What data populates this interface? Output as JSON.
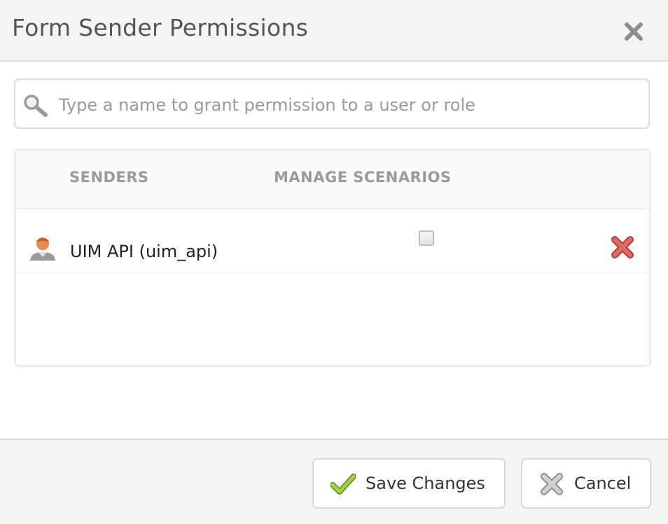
{
  "dialog": {
    "title": "Form Sender Permissions",
    "close_icon": "close-icon"
  },
  "search": {
    "icon": "search-icon",
    "placeholder": "Type a name to grant permission to a user or role",
    "value": ""
  },
  "table": {
    "columns": [
      "SENDERS",
      "MANAGE SCENARIOS"
    ],
    "rows": [
      {
        "icon": "user-icon",
        "name": "UIM API (uim_api)",
        "manage_scenarios": false,
        "remove_icon": "remove-icon"
      }
    ]
  },
  "footer": {
    "save_label": "Save Changes",
    "save_icon": "checkmark-icon",
    "cancel_label": "Cancel",
    "cancel_icon": "cancel-x-icon"
  },
  "colors": {
    "header_bg": "#f4f4f4",
    "title_text": "#555555",
    "column_header_text": "#9a9a9a",
    "remove_red": "#d9534f",
    "save_green": "#8dc63f"
  }
}
